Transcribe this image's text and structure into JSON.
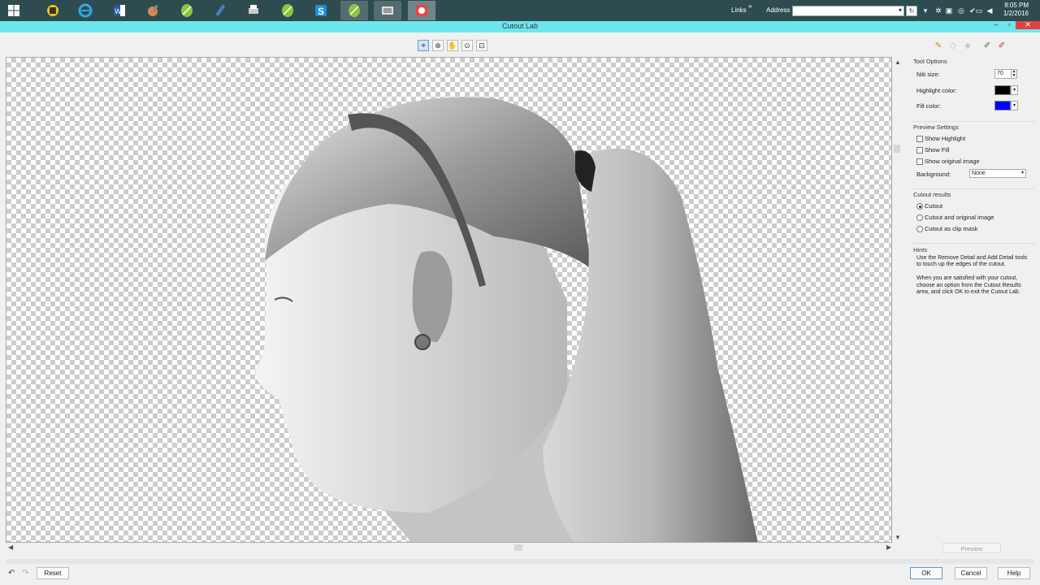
{
  "taskbar": {
    "links_label": "Links",
    "address_label": "Address",
    "address_value": "",
    "clock_time": "8:05 PM",
    "clock_date": "1/2/2016",
    "apps": [
      "start-icon",
      "scanner-icon",
      "internet-explorer-icon",
      "word-icon",
      "paint-icon",
      "corel-leaf-icon",
      "pencil-icon",
      "printer-icon",
      "corel-leaf-icon",
      "skype-icon",
      "corel-leaf-icon",
      "photo-viewer-icon",
      "screen-recorder-icon"
    ]
  },
  "window": {
    "title": "Cutout Lab"
  },
  "panel": {
    "tool_options_title": "Tool Options",
    "nib_size_label": "Nib size:",
    "nib_size_value": "70",
    "highlight_color_label": "Highlight color:",
    "highlight_color": "#000000",
    "fill_color_label": "Fill color:",
    "fill_color": "#0000ff",
    "preview_settings_title": "Preview Settings",
    "show_highlight": "Show Highlight",
    "show_fill": "Show Fill",
    "show_original": "Show original image",
    "background_label": "Background:",
    "background_value": "None",
    "cutout_results_title": "Cutout results",
    "result_cutout": "Cutout",
    "result_cutout_original": "Cutout and original image",
    "result_clip_mask": "Cutout as clip mask",
    "hints_title": "Hints",
    "hints_p1": "Use the Remove Detail and Add Detail tools to touch up the edges of the cutout.",
    "hints_p2": "When you are satisfied with your cutout, choose an option from the Cutout Results area, and click OK to exit the Cutout Lab.",
    "preview_button": "Preview"
  },
  "footer": {
    "reset": "Reset",
    "ok": "OK",
    "cancel": "Cancel",
    "help": "Help"
  }
}
